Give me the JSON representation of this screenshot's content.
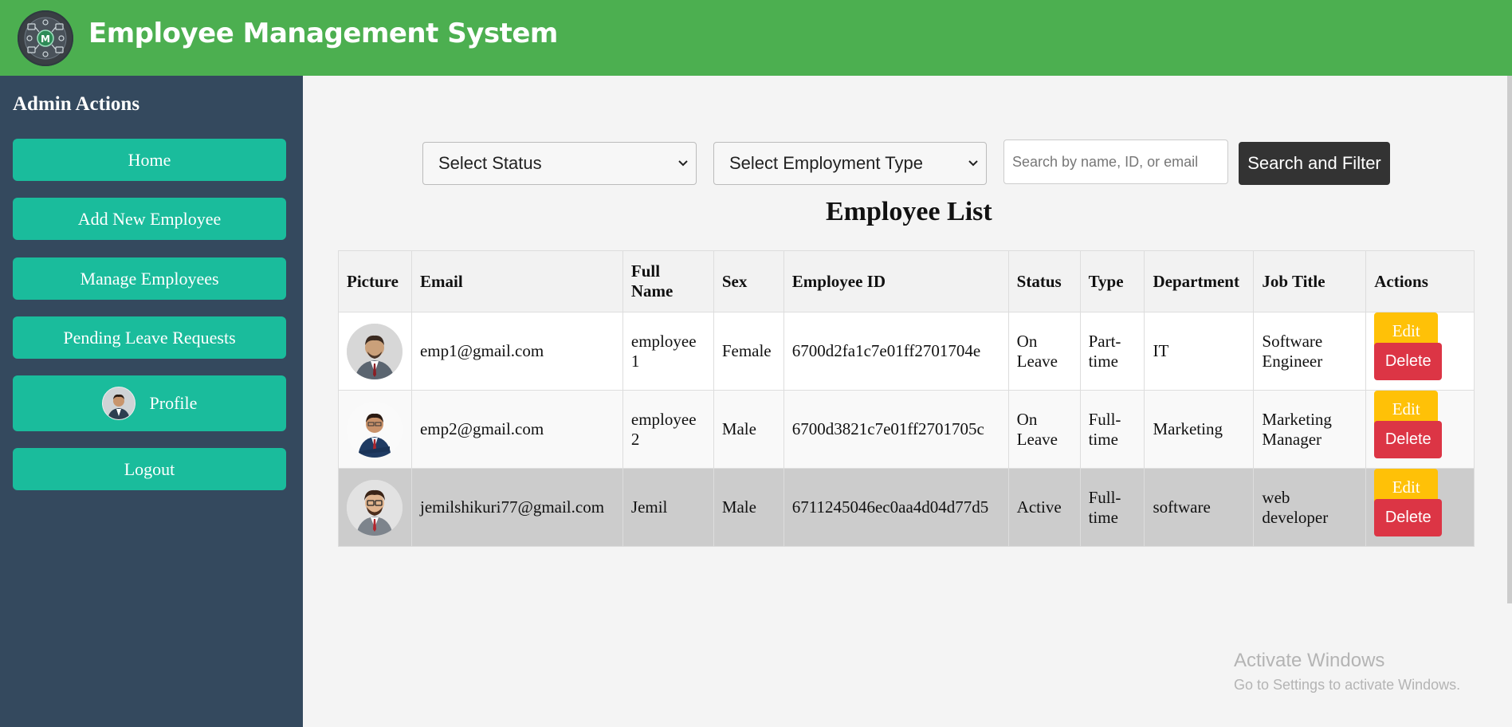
{
  "header": {
    "title": "Employee Management System",
    "logo_icon": "gear-network-logo"
  },
  "sidebar": {
    "heading": "Admin Actions",
    "items": [
      {
        "label": "Home"
      },
      {
        "label": "Add New Employee"
      },
      {
        "label": "Manage Employees"
      },
      {
        "label": "Pending Leave Requests"
      },
      {
        "label": "Profile",
        "icon": "user-avatar"
      },
      {
        "label": "Logout"
      }
    ]
  },
  "filters": {
    "status_select": "Select Status",
    "type_select": "Select Employment Type",
    "search_placeholder": "Search by name, ID, or email",
    "search_button": "Search and Filter"
  },
  "list_title": "Employee List",
  "table": {
    "headers": [
      "Picture",
      "Email",
      "Full Name",
      "Sex",
      "Employee ID",
      "Status",
      "Type",
      "Department",
      "Job Title",
      "Actions"
    ],
    "rows": [
      {
        "email": "emp1@gmail.com",
        "full_name": "employee 1",
        "sex": "Female",
        "employee_id": "6700d2fa1c7e01ff2701704e",
        "status": "On Leave",
        "type": "Part-time",
        "department": "IT",
        "job_title": "Software Engineer"
      },
      {
        "email": "emp2@gmail.com",
        "full_name": "employee 2",
        "sex": "Male",
        "employee_id": "6700d3821c7e01ff2701705c",
        "status": "On Leave",
        "type": "Full-time",
        "department": "Marketing",
        "job_title": "Marketing Manager"
      },
      {
        "email": "jemilshikuri77@gmail.com",
        "full_name": "Jemil",
        "sex": "Male",
        "employee_id": "6711245046ec0aa4d04d77d5",
        "status": "Active",
        "type": "Full-time",
        "department": "software",
        "job_title": "web developer"
      }
    ],
    "edit_label": "Edit",
    "delete_label": "Delete"
  },
  "watermark": {
    "title": "Activate Windows",
    "subtitle": "Go to Settings to activate Windows."
  },
  "colors": {
    "header": "#4caf50",
    "sidebar": "#34495e",
    "sidebar_button": "#1abc9c",
    "edit": "#ffc107",
    "delete": "#dc3545",
    "search_button": "#333333"
  }
}
